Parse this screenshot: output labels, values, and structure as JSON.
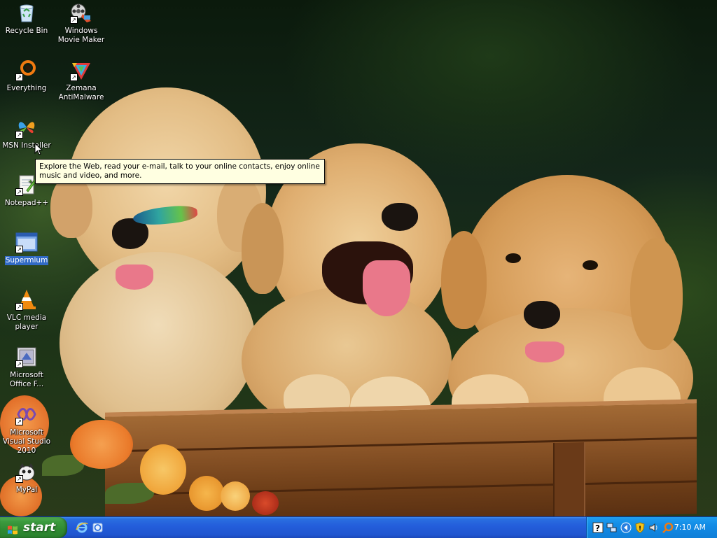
{
  "desktop": {
    "icons": [
      {
        "label": "Recycle Bin",
        "icon": "recycle-bin-icon"
      },
      {
        "label": "Windows Movie Maker",
        "icon": "movie-maker-icon"
      },
      {
        "label": "Everything",
        "icon": "everything-search-icon"
      },
      {
        "label": "Zemana AntiMalware",
        "icon": "zemana-icon"
      },
      {
        "label": "MSN Installer",
        "icon": "msn-butterfly-icon"
      },
      {
        "label": "Notepad++",
        "icon": "notepad-plus-plus-icon"
      },
      {
        "label": "Supermium",
        "icon": "supermium-window-icon"
      },
      {
        "label": "VLC media player",
        "icon": "vlc-cone-icon"
      },
      {
        "label": "Microsoft Office F...",
        "icon": "office-file-icon"
      },
      {
        "label": "Microsoft Visual Studio 2010",
        "icon": "visual-studio-icon"
      },
      {
        "label": "MyPal",
        "icon": "mypal-icon"
      }
    ],
    "selected": "Supermium"
  },
  "tooltip": {
    "text": "Explore the Web, read your e-mail, talk to your online contacts, enjoy online music and video, and more."
  },
  "taskbar": {
    "start_label": "start",
    "quick_launch": [
      "internet-explorer-icon",
      "desktop-switch-icon"
    ],
    "tray_icons": [
      "help-icon",
      "network-icon",
      "wifi-icon",
      "shield-icon",
      "volume-icon",
      "search-tray-icon"
    ],
    "clock": "7:10 AM"
  },
  "colors": {
    "taskbar": "#245edb",
    "start_green": "#3c9b3f",
    "tray": "#138be5",
    "tooltip_bg": "#ffffe1",
    "selection": "#316ac5"
  }
}
